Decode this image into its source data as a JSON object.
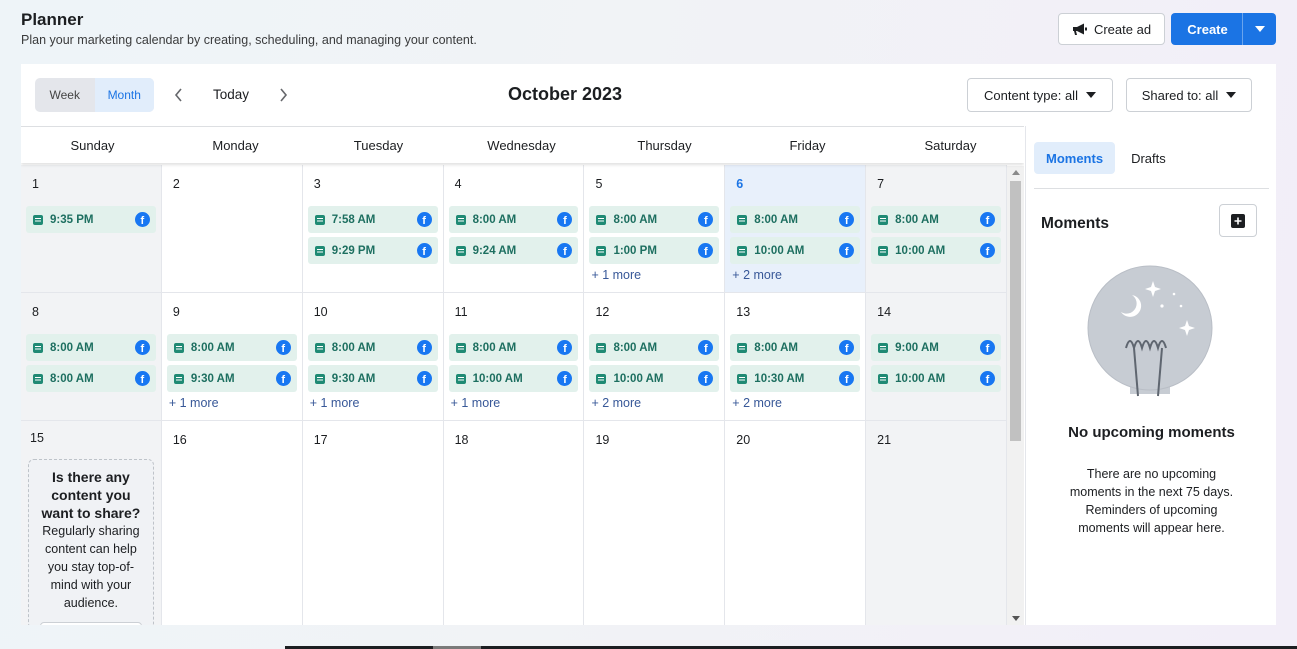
{
  "header": {
    "title": "Planner",
    "subtitle": "Plan your marketing calendar by creating, scheduling, and managing your content."
  },
  "actions": {
    "create_ad": "Create ad",
    "create": "Create",
    "brand_color": "#1b74e4"
  },
  "toolbar": {
    "view_week": "Week",
    "view_month": "Month",
    "today": "Today",
    "month_title": "October 2023",
    "content_type": "Content type: all",
    "shared_to": "Shared to: all"
  },
  "weekdays": [
    "Sunday",
    "Monday",
    "Tuesday",
    "Wednesday",
    "Thursday",
    "Friday",
    "Saturday"
  ],
  "weeks": [
    [
      {
        "day": "1",
        "weekend": true,
        "posts": [
          "9:35 PM"
        ],
        "more": ""
      },
      {
        "day": "2",
        "posts": [],
        "more": ""
      },
      {
        "day": "3",
        "posts": [
          "7:58 AM",
          "9:29 PM"
        ],
        "more": ""
      },
      {
        "day": "4",
        "posts": [
          "8:00 AM",
          "9:24 AM"
        ],
        "more": ""
      },
      {
        "day": "5",
        "posts": [
          "8:00 AM",
          "1:00 PM"
        ],
        "more": "+ 1 more"
      },
      {
        "day": "6",
        "today": true,
        "posts": [
          "8:00 AM",
          "10:00 AM"
        ],
        "more": "+ 2 more"
      },
      {
        "day": "7",
        "weekend": true,
        "posts": [
          "8:00 AM",
          "10:00 AM"
        ],
        "more": ""
      }
    ],
    [
      {
        "day": "8",
        "weekend": true,
        "posts": [
          "8:00 AM",
          "8:00 AM"
        ],
        "more": ""
      },
      {
        "day": "9",
        "posts": [
          "8:00 AM",
          "9:30 AM"
        ],
        "more": "+ 1 more"
      },
      {
        "day": "10",
        "posts": [
          "8:00 AM",
          "9:30 AM"
        ],
        "more": "+ 1 more"
      },
      {
        "day": "11",
        "posts": [
          "8:00 AM",
          "10:00 AM"
        ],
        "more": "+ 1 more"
      },
      {
        "day": "12",
        "posts": [
          "8:00 AM",
          "10:00 AM"
        ],
        "more": "+ 2 more"
      },
      {
        "day": "13",
        "posts": [
          "8:00 AM",
          "10:30 AM"
        ],
        "more": "+ 2 more"
      },
      {
        "day": "14",
        "weekend": true,
        "posts": [
          "9:00 AM",
          "10:00 AM"
        ],
        "more": ""
      }
    ],
    [
      {
        "day": "15",
        "weekend": true,
        "tip": true,
        "posts": [],
        "more": ""
      },
      {
        "day": "16",
        "posts": [],
        "more": ""
      },
      {
        "day": "17",
        "posts": [],
        "more": ""
      },
      {
        "day": "18",
        "posts": [],
        "more": ""
      },
      {
        "day": "19",
        "posts": [],
        "more": ""
      },
      {
        "day": "20",
        "posts": [],
        "more": ""
      },
      {
        "day": "21",
        "weekend": true,
        "posts": [],
        "more": ""
      }
    ]
  ],
  "tip": {
    "question": "Is there any content you want to share?",
    "body": "Regularly sharing content can help you stay top-of-mind with your audience."
  },
  "sidebar": {
    "tab_moments": "Moments",
    "tab_drafts": "Drafts",
    "heading": "Moments",
    "empty_title": "No upcoming moments",
    "empty_desc": "There are no upcoming moments in the next 75 days. Reminders of upcoming moments will appear here."
  }
}
